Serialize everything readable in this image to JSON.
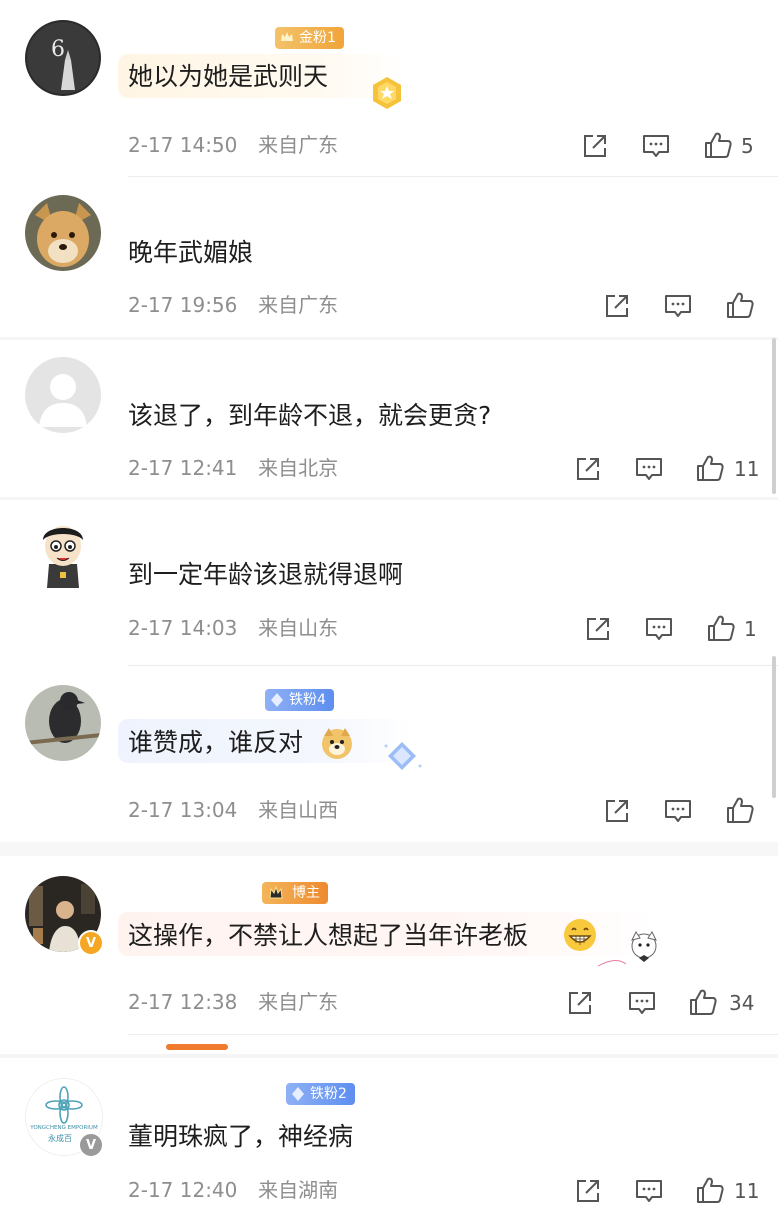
{
  "comments": [
    {
      "username": "",
      "badge": "金粉1",
      "text": "她以为她是武则天",
      "time": "2-17 14:50",
      "location": "来自广东",
      "likes": "5"
    },
    {
      "username": "",
      "badge": "",
      "text": "晚年武媚娘",
      "time": "2-17 19:56",
      "location": "来自广东",
      "likes": ""
    },
    {
      "username": "",
      "badge": "",
      "text": "该退了，到年龄不退，就会更贪?",
      "time": "2-17 12:41",
      "location": "来自北京",
      "likes": "11"
    },
    {
      "username": "",
      "badge": "",
      "text": "到一定年龄该退就得退啊",
      "time": "2-17 14:03",
      "location": "来自山东",
      "likes": "1"
    },
    {
      "username": "",
      "badge": "铁粉4",
      "text": "谁赞成，谁反对",
      "time": "2-17 13:04",
      "location": "来自山西",
      "likes": ""
    },
    {
      "username": "",
      "badge": "博主",
      "text": "这操作，不禁让人想起了当年许老板",
      "time": "2-17 12:38",
      "location": "来自广东",
      "likes": "34"
    },
    {
      "username": "",
      "badge": "铁粉2",
      "text": "董明珠疯了，神经病",
      "time": "2-17 12:40",
      "location": "来自湖南",
      "likes": "11"
    }
  ],
  "avatar_texts": {
    "emporium_en": "YONGCHENG EMPORIUM",
    "emporium_cn": "永成百"
  },
  "verified_mark": "V",
  "icons": {
    "repost": "share-square-icon",
    "comment": "comment-bubble-icon",
    "like": "thumbs-up-icon"
  },
  "colors": {
    "meta_gray": "#8e8e8e",
    "icon_gray": "#555555",
    "accent_orange": "#f07a2d",
    "gold_badge": "#f0a53a",
    "iron_badge": "#5d8ef0"
  }
}
